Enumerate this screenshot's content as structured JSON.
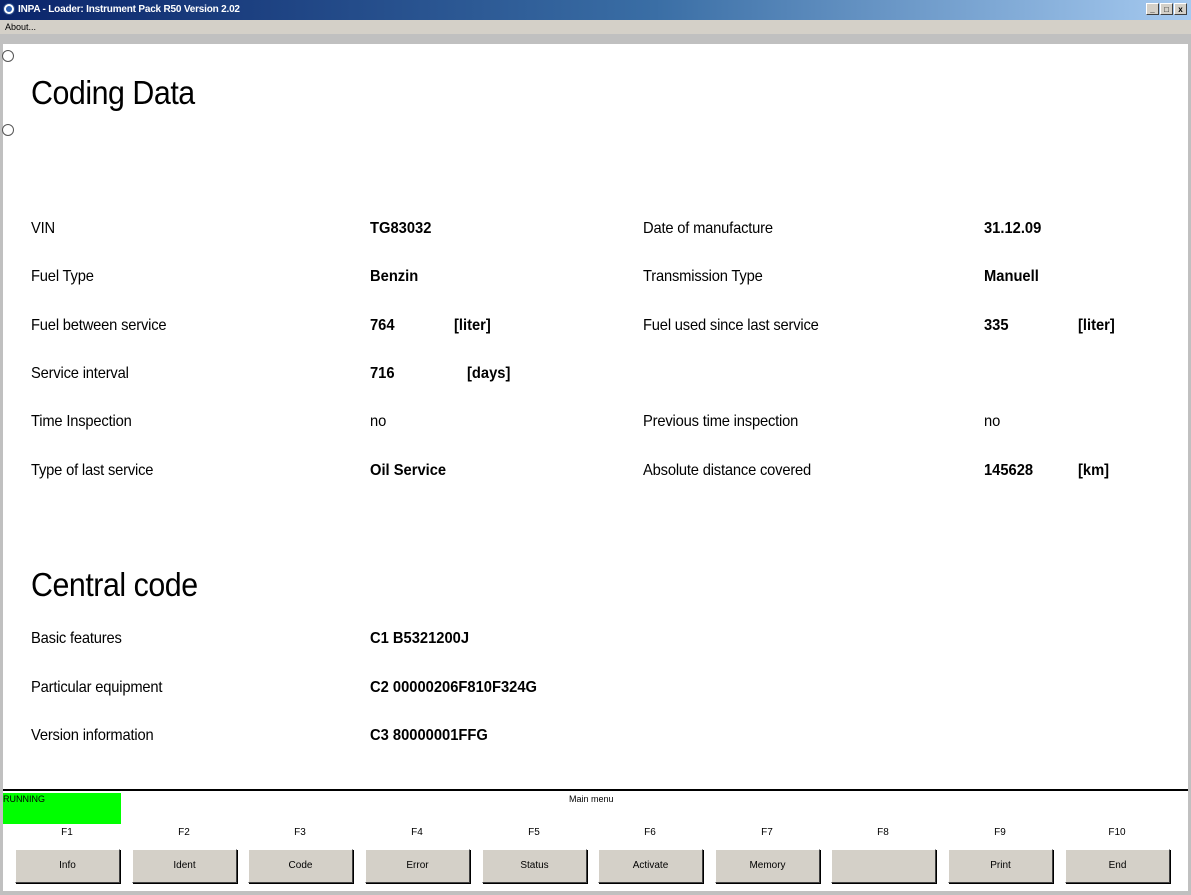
{
  "window": {
    "title": "INPA - Loader: Instrument Pack R50 Version 2.02",
    "controls": [
      "_",
      "□",
      "x"
    ]
  },
  "menubar": {
    "about": "About..."
  },
  "coding": {
    "heading": "Coding Data",
    "rows": [
      {
        "label": "VIN",
        "value": "TG83032",
        "unit": ""
      },
      {
        "label": "Fuel Type",
        "value": "Benzin",
        "unit": ""
      },
      {
        "label": "Fuel between service",
        "value": "764",
        "unit": "[liter]"
      },
      {
        "label": "Service interval",
        "value": "716",
        "unit": "[days]"
      },
      {
        "label": "Time Inspection",
        "value": "no",
        "unit": ""
      },
      {
        "label": "Type of last service",
        "value": "Oil Service",
        "unit": ""
      }
    ],
    "right_rows": [
      {
        "label": "Date of manufacture",
        "value": "31.12.09",
        "unit": ""
      },
      {
        "label": "Transmission Type",
        "value": "Manuell",
        "unit": ""
      },
      {
        "label": "Fuel used since last service",
        "value": "335",
        "unit": "[liter]"
      },
      {
        "label": "Previous time inspection",
        "value": "no",
        "unit": ""
      },
      {
        "label": "Absolute distance covered",
        "value": "145628",
        "unit": "[km]"
      }
    ]
  },
  "central": {
    "heading": "Central code",
    "rows": [
      {
        "label": "Basic features",
        "value": "C1 B5321200J"
      },
      {
        "label": "Particular equipment",
        "value": "C2 00000206F810F324G"
      },
      {
        "label": "Version information",
        "value": "C3 80000001FFG"
      }
    ]
  },
  "footer": {
    "status": "RUNNING",
    "status_color": "#00ff00",
    "menu_caption": "Main menu",
    "keys": [
      {
        "key": "F1",
        "label": "Info"
      },
      {
        "key": "F2",
        "label": "Ident"
      },
      {
        "key": "F3",
        "label": "Code"
      },
      {
        "key": "F4",
        "label": "Error"
      },
      {
        "key": "F5",
        "label": "Status"
      },
      {
        "key": "F6",
        "label": "Activate"
      },
      {
        "key": "F7",
        "label": "Memory"
      },
      {
        "key": "F8",
        "label": ""
      },
      {
        "key": "F9",
        "label": "Print"
      },
      {
        "key": "F10",
        "label": "End"
      }
    ]
  }
}
